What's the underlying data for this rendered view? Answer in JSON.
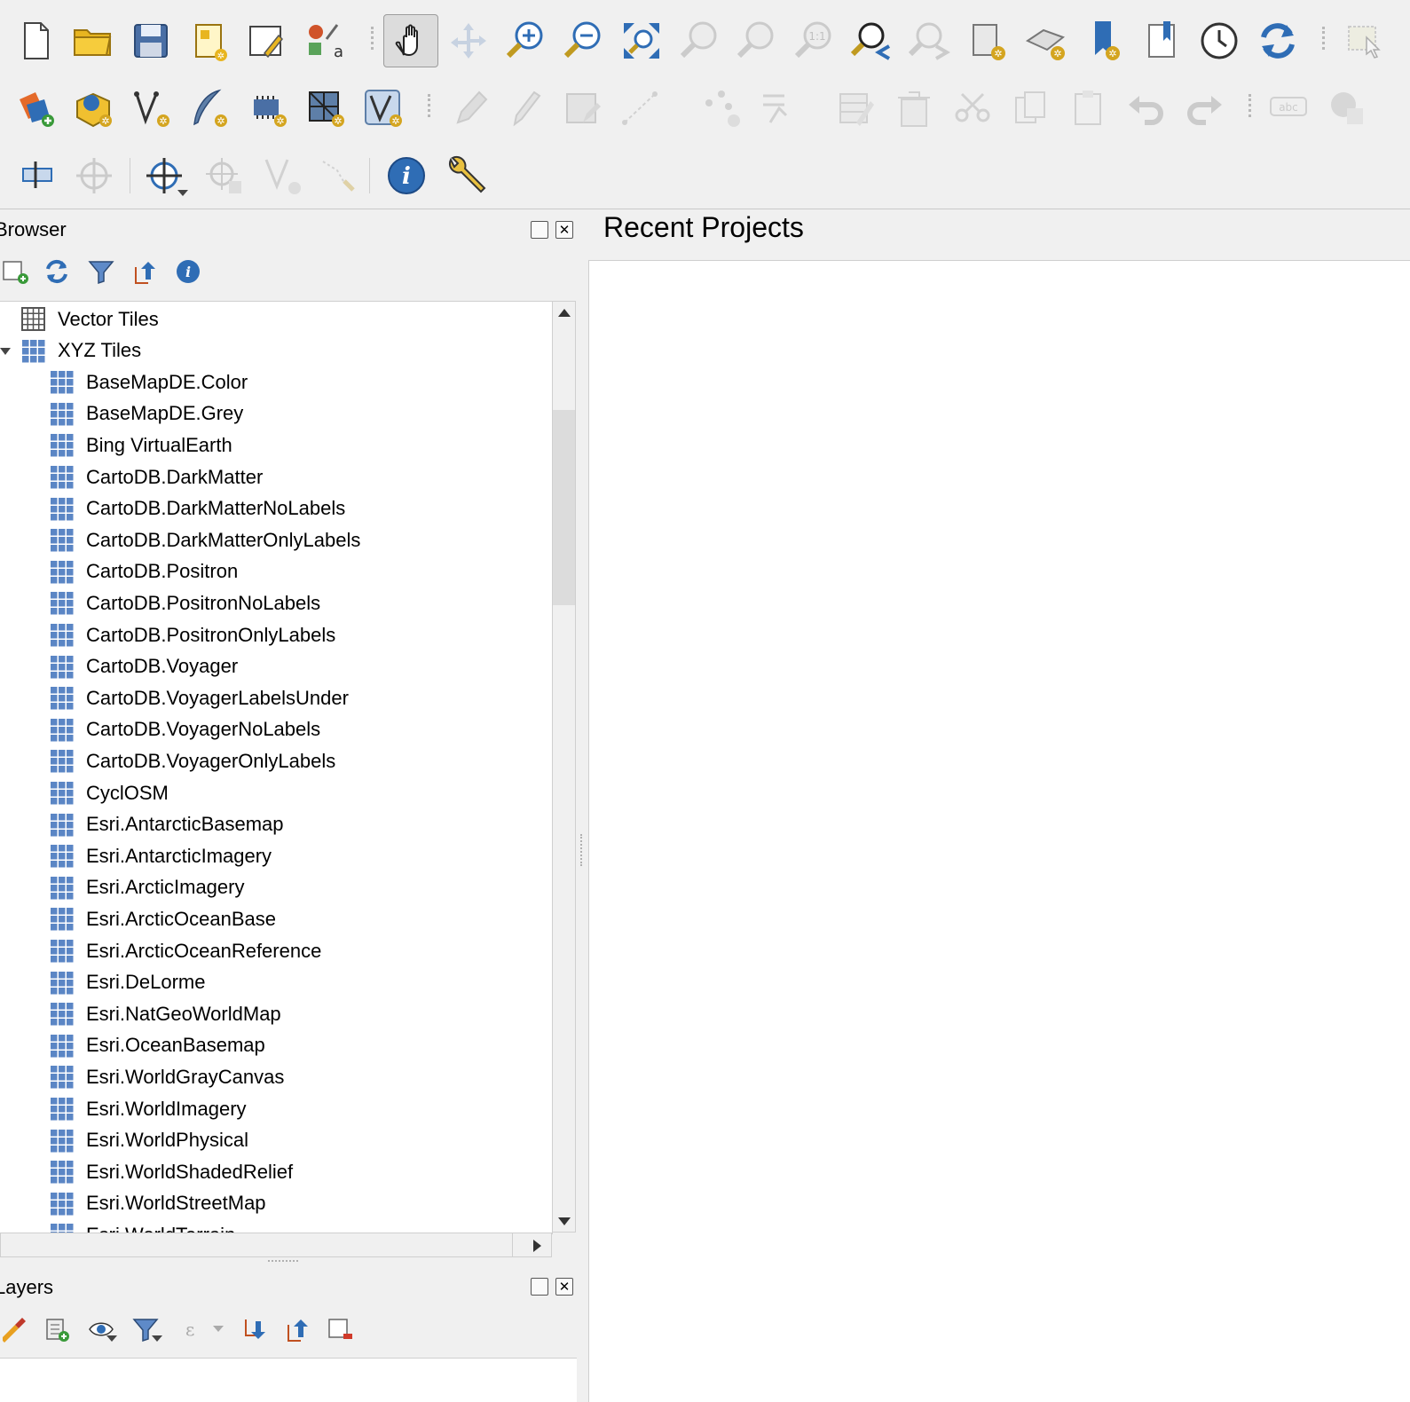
{
  "toolbars": {
    "project": [
      "new-project",
      "open-project",
      "save-project",
      "new-print-layout",
      "layout-manager",
      "style-manager"
    ],
    "navigation": [
      "pan-map",
      "pan-to-selection",
      "zoom-in",
      "zoom-out",
      "zoom-full",
      "zoom-to-selection",
      "zoom-to-layer",
      "zoom-native",
      "zoom-last",
      "zoom-next",
      "new-map-view",
      "new-3d-map-view",
      "new-spatial-bookmark",
      "show-bookmarks",
      "temporal-controller",
      "refresh"
    ]
  },
  "browser": {
    "title": "Browser",
    "tree": [
      {
        "label": "Vector Tiles",
        "level": 0
      },
      {
        "label": "XYZ Tiles",
        "level": 0,
        "expanded": true
      },
      {
        "label": "BaseMapDE.Color",
        "level": 1
      },
      {
        "label": "BaseMapDE.Grey",
        "level": 1
      },
      {
        "label": "Bing VirtualEarth",
        "level": 1
      },
      {
        "label": "CartoDB.DarkMatter",
        "level": 1
      },
      {
        "label": "CartoDB.DarkMatterNoLabels",
        "level": 1
      },
      {
        "label": "CartoDB.DarkMatterOnlyLabels",
        "level": 1
      },
      {
        "label": "CartoDB.Positron",
        "level": 1
      },
      {
        "label": "CartoDB.PositronNoLabels",
        "level": 1
      },
      {
        "label": "CartoDB.PositronOnlyLabels",
        "level": 1
      },
      {
        "label": "CartoDB.Voyager",
        "level": 1
      },
      {
        "label": "CartoDB.VoyagerLabelsUnder",
        "level": 1
      },
      {
        "label": "CartoDB.VoyagerNoLabels",
        "level": 1
      },
      {
        "label": "CartoDB.VoyagerOnlyLabels",
        "level": 1
      },
      {
        "label": "CyclOSM",
        "level": 1
      },
      {
        "label": "Esri.AntarcticBasemap",
        "level": 1
      },
      {
        "label": "Esri.AntarcticImagery",
        "level": 1
      },
      {
        "label": "Esri.ArcticImagery",
        "level": 1
      },
      {
        "label": "Esri.ArcticOceanBase",
        "level": 1
      },
      {
        "label": "Esri.ArcticOceanReference",
        "level": 1
      },
      {
        "label": "Esri.DeLorme",
        "level": 1
      },
      {
        "label": "Esri.NatGeoWorldMap",
        "level": 1
      },
      {
        "label": "Esri.OceanBasemap",
        "level": 1
      },
      {
        "label": "Esri.WorldGrayCanvas",
        "level": 1
      },
      {
        "label": "Esri.WorldImagery",
        "level": 1
      },
      {
        "label": "Esri.WorldPhysical",
        "level": 1
      },
      {
        "label": "Esri.WorldShadedRelief",
        "level": 1
      },
      {
        "label": "Esri.WorldStreetMap",
        "level": 1
      },
      {
        "label": "Esri.WorldTerrain",
        "level": 1
      }
    ]
  },
  "layers": {
    "title": "Layers"
  },
  "welcome": {
    "recent_title": "Recent Projects"
  },
  "colors": {
    "accent_blue": "#2f6db5",
    "tile_blue": "#5b86c5",
    "tree_bg": "#ffffff",
    "chrome_bg": "#f0f0f0"
  }
}
